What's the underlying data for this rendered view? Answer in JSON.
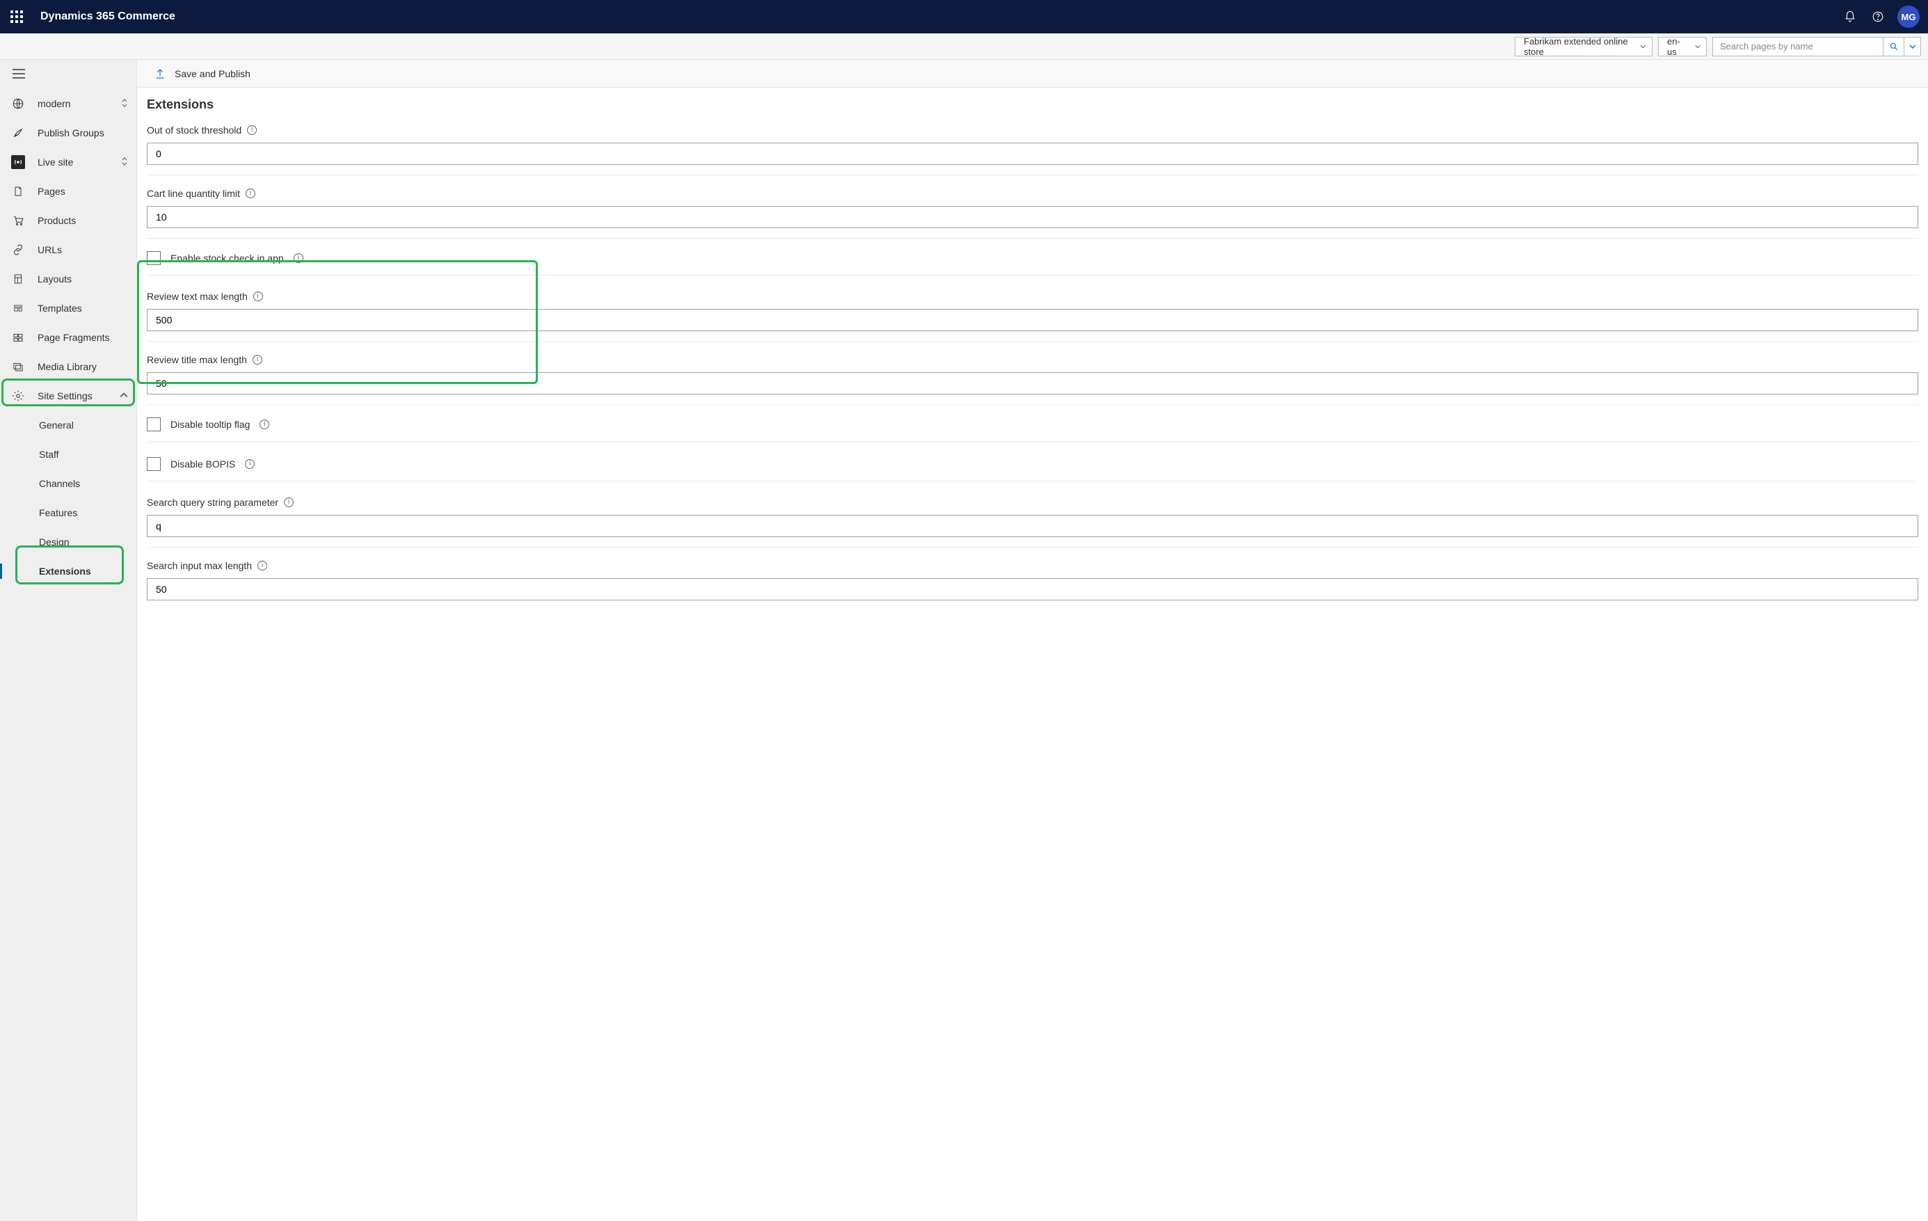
{
  "header": {
    "product": "Dynamics 365 Commerce",
    "avatar_initials": "MG"
  },
  "subheader": {
    "site_dropdown": "Fabrikam extended online store",
    "lang_dropdown": "en-us",
    "search_placeholder": "Search pages by name"
  },
  "toolbar": {
    "save_publish": "Save and Publish"
  },
  "sidebar": {
    "site_name": "modern",
    "items": {
      "publish_groups": "Publish Groups",
      "live_site": "Live site",
      "pages": "Pages",
      "products": "Products",
      "urls": "URLs",
      "layouts": "Layouts",
      "templates": "Templates",
      "page_fragments": "Page Fragments",
      "media_library": "Media Library",
      "site_settings": "Site Settings"
    },
    "settings_children": {
      "general": "General",
      "staff": "Staff",
      "channels": "Channels",
      "features": "Features",
      "design": "Design",
      "extensions": "Extensions"
    }
  },
  "page": {
    "title": "Extensions",
    "fields": {
      "out_of_stock_label": "Out of stock threshold",
      "out_of_stock_value": "0",
      "cart_qty_label": "Cart line quantity limit",
      "cart_qty_value": "10",
      "enable_stock_check_label": "Enable stock check in app",
      "review_text_label": "Review text max length",
      "review_text_value": "500",
      "review_title_label": "Review title max length",
      "review_title_value": "50",
      "disable_tooltip_label": "Disable tooltip flag",
      "disable_bopis_label": "Disable BOPIS",
      "search_query_label": "Search query string parameter",
      "search_query_value": "q",
      "search_input_max_label": "Search input max length",
      "search_input_max_value": "50"
    }
  }
}
